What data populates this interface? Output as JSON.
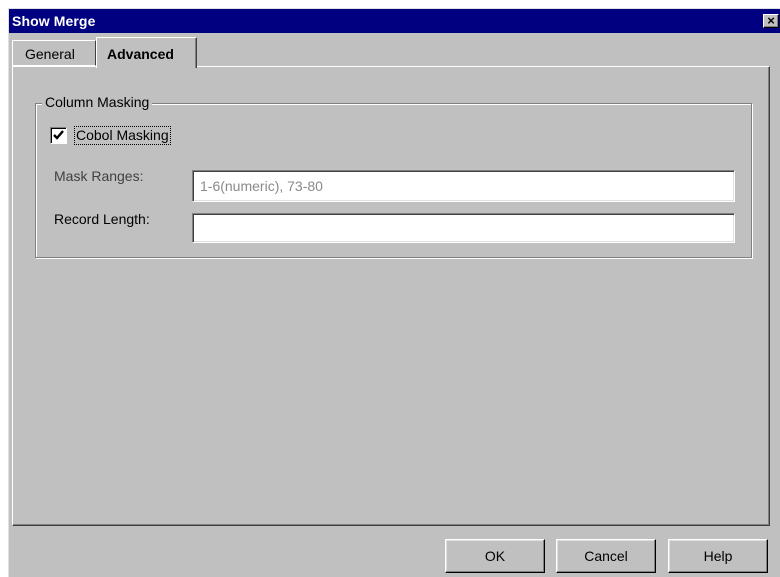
{
  "window": {
    "title": "Show Merge",
    "close_glyph": "×",
    "close_icon": "close-icon"
  },
  "tabs": [
    {
      "label": "General",
      "selected": false
    },
    {
      "label": "Advanced",
      "selected": true
    }
  ],
  "column_masking": {
    "group_label": "Column Masking",
    "cobol_masking": {
      "label": "Cobol Masking",
      "checked": true
    },
    "mask_ranges": {
      "label": "Mask Ranges:",
      "value": "1-6(numeric), 73-80",
      "enabled": false
    },
    "record_length": {
      "label": "Record Length:",
      "value": "",
      "enabled": true
    }
  },
  "buttons": {
    "ok": "OK",
    "cancel": "Cancel",
    "help": "Help"
  }
}
